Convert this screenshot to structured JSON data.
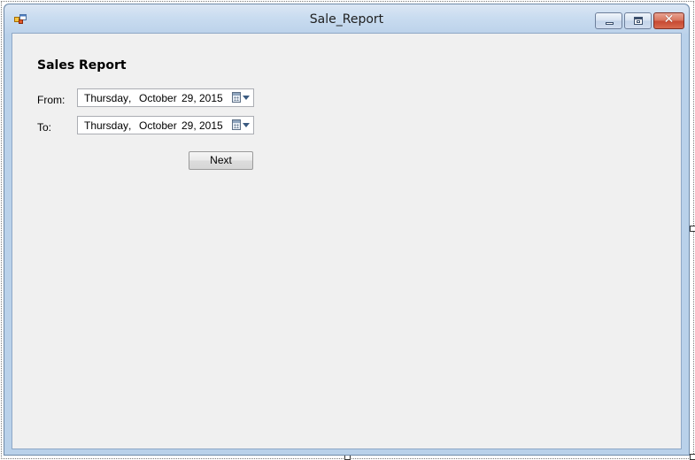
{
  "window": {
    "title": "Sale_Report",
    "close_glyph": "✕",
    "icons": {
      "app": "app-form-icon",
      "minimize": "minimize-icon",
      "maximize": "maximize-icon",
      "close": "close-icon"
    }
  },
  "form": {
    "heading": "Sales Report",
    "from": {
      "label": "From:",
      "day_of_week": "Thursday",
      "separator": ",",
      "month": "October",
      "day": "29,",
      "year": "2015"
    },
    "to": {
      "label": "To:",
      "day_of_week": "Thursday",
      "separator": ",",
      "month": "October",
      "day": "29,",
      "year": "2015"
    },
    "next_label": "Next"
  },
  "colors": {
    "title_bar": "#c9dcf0",
    "client_background": "#f0f0f0",
    "close_button": "#c74a33"
  }
}
